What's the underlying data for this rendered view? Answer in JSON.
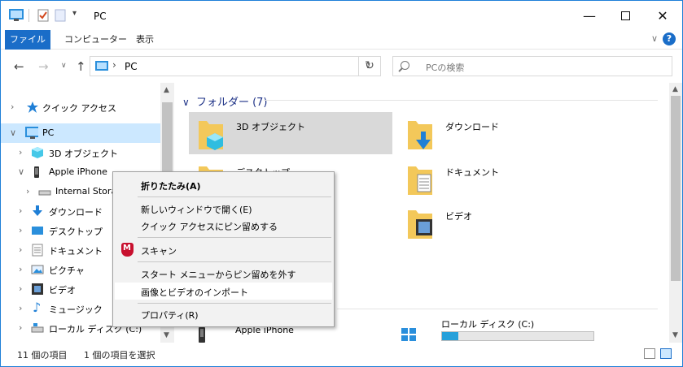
{
  "window": {
    "title": "PC",
    "accent": "#1a6dc8"
  },
  "ribbon": {
    "tabs": [
      "ファイル",
      "コンピューター",
      "表示"
    ]
  },
  "address": {
    "path": "PC"
  },
  "search": {
    "placeholder": "PCの検索"
  },
  "nav": {
    "items": [
      {
        "label": "クイック アクセス",
        "icon": "star-icon"
      },
      {
        "label": "PC",
        "icon": "computer-icon"
      },
      {
        "label": "3D オブジェクト",
        "icon": "cube-icon"
      },
      {
        "label": "Apple iPhone",
        "icon": "phone-icon"
      },
      {
        "label": "Internal Stora",
        "icon": "drive-icon"
      },
      {
        "label": "ダウンロード",
        "icon": "download-icon"
      },
      {
        "label": "デスクトップ",
        "icon": "desktop-icon"
      },
      {
        "label": "ドキュメント",
        "icon": "document-icon"
      },
      {
        "label": "ピクチャ",
        "icon": "picture-icon"
      },
      {
        "label": "ビデオ",
        "icon": "video-icon"
      },
      {
        "label": "ミュージック",
        "icon": "music-icon"
      },
      {
        "label": "ローカル ディスク (C:)",
        "icon": "local-disk-icon"
      }
    ]
  },
  "content": {
    "group_title": "フォルダー (7)",
    "folders": [
      "3D オブジェクト",
      "ダウンロード",
      "デスクトップ",
      "ドキュメント",
      "ビデオ"
    ],
    "devices": [
      {
        "label": "Apple iPhone"
      },
      {
        "label": "ローカル ディスク (C:)",
        "usage": 0.11
      }
    ]
  },
  "context_menu": {
    "items": [
      "折りたたみ(A)",
      "新しいウィンドウで開く(E)",
      "クイック アクセスにピン留めする",
      "スキャン",
      "スタート メニューからピン留めを外す",
      "画像とビデオのインポート",
      "プロパティ(R)"
    ]
  },
  "status": {
    "count": "11 個の項目",
    "selected": "1 個の項目を選択"
  }
}
